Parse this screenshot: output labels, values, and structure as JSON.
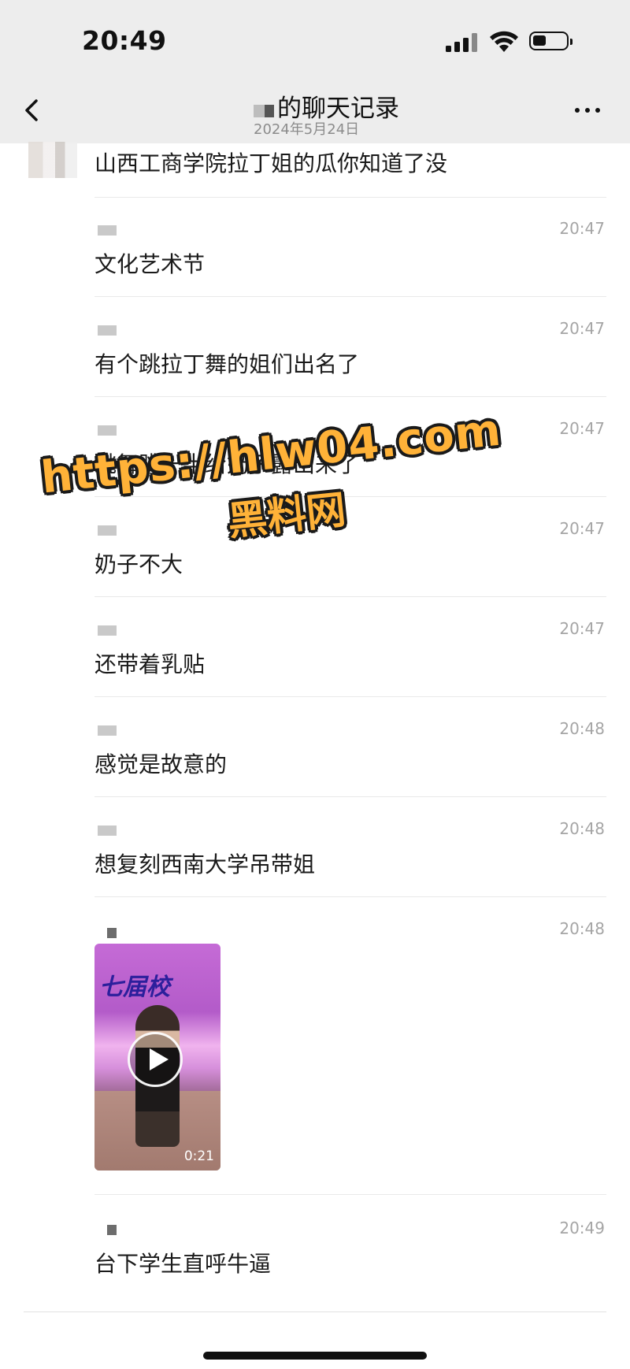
{
  "status_bar": {
    "time": "20:49"
  },
  "header": {
    "title": "的聊天记录",
    "date": "2024年5月24日",
    "icons": {
      "back": "chevron-left-icon",
      "more": "more-dots-icon"
    }
  },
  "first_message": {
    "text": "山西工商学院拉丁姐的瓜你知道了没"
  },
  "messages": [
    {
      "time": "20:47",
      "text": "文化艺术节"
    },
    {
      "time": "20:47",
      "text": "有个跳拉丁舞的姐们出名了"
    },
    {
      "time": "20:47",
      "text": "跳舞跳一半给奶子露出来了"
    },
    {
      "time": "20:47",
      "text": "奶子不大"
    },
    {
      "time": "20:47",
      "text": "还带着乳贴"
    },
    {
      "time": "20:48",
      "text": "感觉是故意的"
    },
    {
      "time": "20:48",
      "text": "想复刻西南大学吊带姐"
    },
    {
      "time": "20:48",
      "video": {
        "duration": "0:21",
        "banner": "七届校"
      }
    },
    {
      "time": "20:49",
      "text": "台下学生直呼牛逼"
    }
  ],
  "watermark": {
    "url": "https://hlw04.com",
    "name": "黑料网"
  },
  "colors": {
    "topbar_bg": "#ededed",
    "watermark": "#ffb238",
    "timestamp": "#a5a5a5"
  }
}
